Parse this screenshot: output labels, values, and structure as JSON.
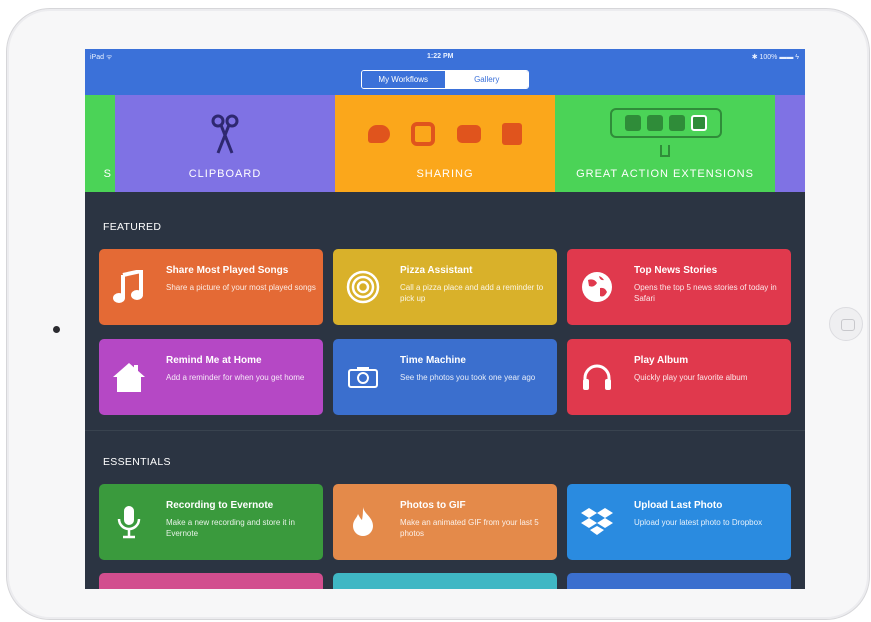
{
  "status_bar": {
    "device": "iPad ᯤ",
    "time": "1:22 PM",
    "battery": "✱ 100% ▬▬ ϟ"
  },
  "segmented": {
    "workflows": "My Workflows",
    "gallery": "Gallery"
  },
  "categories": [
    {
      "label": "S",
      "color": "#4bd357"
    },
    {
      "label": "CLIPBOARD",
      "color": "#7f72e4"
    },
    {
      "label": "SHARING",
      "color": "#fba71b"
    },
    {
      "label": "GREAT ACTION EXTENSIONS",
      "color": "#4bd357"
    }
  ],
  "featured": {
    "title": "FEATURED",
    "cards": [
      {
        "title": "Share Most Played Songs",
        "desc": "Share a picture of your most played songs",
        "color": "#e46a35",
        "icon": "music-note-icon"
      },
      {
        "title": "Pizza Assistant",
        "desc": "Call a pizza place and add a reminder to pick up",
        "color": "#d9b12a",
        "icon": "target-icon"
      },
      {
        "title": "Top News Stories",
        "desc": "Opens the top 5 news stories of today in Safari",
        "color": "#e0394d",
        "icon": "globe-icon"
      },
      {
        "title": "Remind Me at Home",
        "desc": "Add a reminder for when you get home",
        "color": "#b548c5",
        "icon": "home-icon"
      },
      {
        "title": "Time Machine",
        "desc": "See the photos you took one year ago",
        "color": "#3b6fce",
        "icon": "camera-icon"
      },
      {
        "title": "Play Album",
        "desc": "Quickly play your favorite album",
        "color": "#e0394d",
        "icon": "headphones-icon"
      }
    ]
  },
  "essentials": {
    "title": "ESSENTIALS",
    "cards": [
      {
        "title": "Recording to Evernote",
        "desc": "Make a new recording and store it in Evernote",
        "color": "#3a9a3d",
        "icon": "microphone-icon"
      },
      {
        "title": "Photos to GIF",
        "desc": "Make an animated GIF from your last 5 photos",
        "color": "#e48a4a",
        "icon": "flame-icon"
      },
      {
        "title": "Upload Last Photo",
        "desc": "Upload your latest photo to Dropbox",
        "color": "#2a8be0",
        "icon": "dropbox-icon"
      }
    ],
    "partial_colors": [
      "#d24e8e",
      "#3fb7c4",
      "#3b6fce"
    ]
  }
}
